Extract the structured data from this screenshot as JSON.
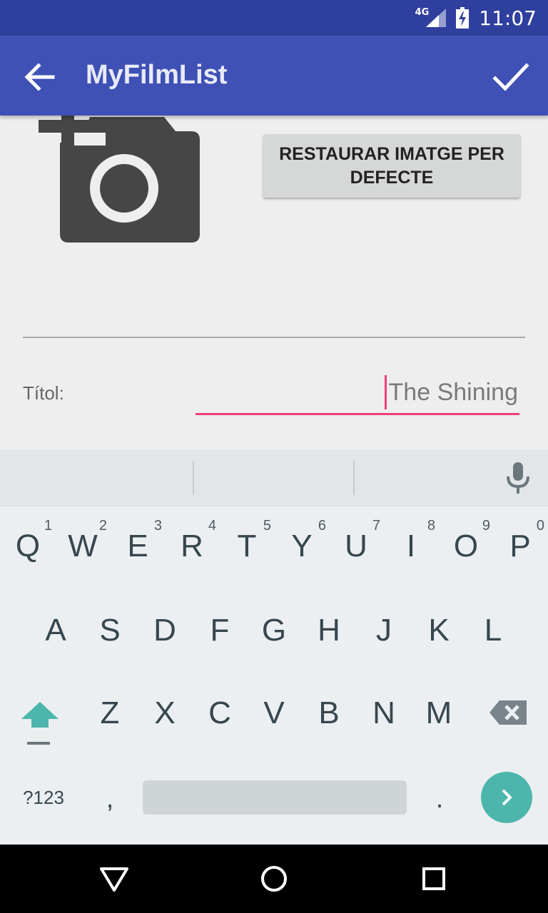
{
  "status_bar": {
    "network": "4G",
    "clock": "11:07"
  },
  "app_bar": {
    "title": "MyFilmList",
    "back_icon": "arrow-back-icon",
    "confirm_icon": "check-icon",
    "background": "#3f51b5"
  },
  "form": {
    "photo_icon": "add-photo-camera-icon",
    "restore_button_label": "RESTAURAR IMATGE PER DEFECTE",
    "title_label": "Títol:",
    "title_value": "The Shining",
    "accent": "#ec407a"
  },
  "keyboard": {
    "mic_icon": "microphone-icon",
    "row1": [
      {
        "letter": "Q",
        "hint": "1"
      },
      {
        "letter": "W",
        "hint": "2"
      },
      {
        "letter": "E",
        "hint": "3"
      },
      {
        "letter": "R",
        "hint": "4"
      },
      {
        "letter": "T",
        "hint": "5"
      },
      {
        "letter": "Y",
        "hint": "6"
      },
      {
        "letter": "U",
        "hint": "7"
      },
      {
        "letter": "I",
        "hint": "8"
      },
      {
        "letter": "O",
        "hint": "9"
      },
      {
        "letter": "P",
        "hint": "0"
      }
    ],
    "row2": [
      "A",
      "S",
      "D",
      "F",
      "G",
      "H",
      "J",
      "K",
      "L"
    ],
    "row3": [
      "Z",
      "X",
      "C",
      "V",
      "B",
      "N",
      "M"
    ],
    "shift_icon": "shift-arrow-icon",
    "backspace_icon": "backspace-icon",
    "symbols_label": "?123",
    "comma_label": ",",
    "period_label": ".",
    "go_icon": "chevron-right-icon",
    "go_color": "#4db6ac"
  },
  "nav_bar": {
    "back_icon": "nav-back-triangle-icon",
    "home_icon": "nav-home-circle-icon",
    "recents_icon": "nav-recents-square-icon"
  }
}
